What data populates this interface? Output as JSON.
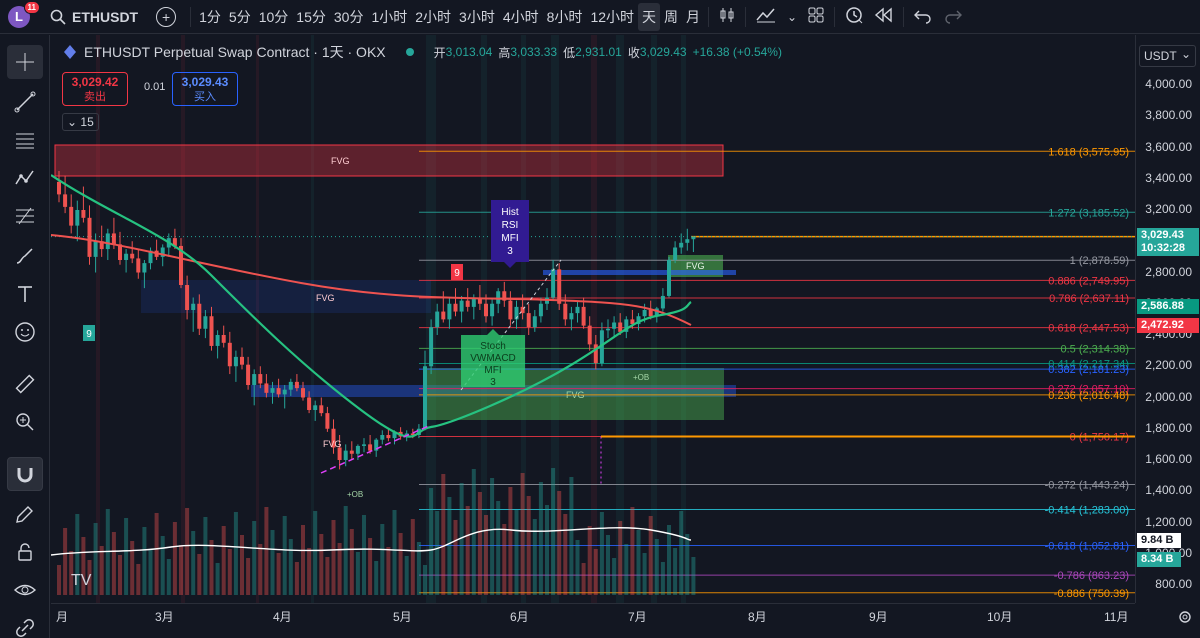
{
  "header": {
    "avatar_letter": "L",
    "notifications": "11",
    "symbol": "ETHUSDT",
    "intervals": [
      "1分",
      "5分",
      "10分",
      "15分",
      "30分",
      "1小时",
      "2小时",
      "3小时",
      "4小时",
      "8小时",
      "12小时",
      "天",
      "周",
      "月"
    ],
    "active_interval": "天"
  },
  "legend": {
    "title": "ETHUSDT Perpetual Swap Contract · 1天 · OKX",
    "open_label": "开",
    "open": "3,013.04",
    "high_label": "高",
    "high": "3,033.33",
    "low_label": "低",
    "low": "2,931.01",
    "close_label": "收",
    "close": "3,029.43",
    "change": "+16.38 (+0.54%)",
    "sell_price": "3,029.42",
    "sell_label": "卖出",
    "spread": "0.01",
    "buy_price": "3,029.43",
    "buy_label": "买入",
    "collapse_count": "15"
  },
  "price_axis": {
    "currency": "USDT",
    "ticks": [
      "4,000.00",
      "3,800.00",
      "3,600.00",
      "3,400.00",
      "3,200.00",
      "3,000.00",
      "2,800.00",
      "2,600.00",
      "2,400.00",
      "2,200.00",
      "2,000.00",
      "1,800.00",
      "1,600.00",
      "1,400.00",
      "1,200.00",
      "1,000.00",
      "800.00"
    ],
    "current_price": "3,029.43",
    "countdown": "10:32:28",
    "ma_green": "2,586.88",
    "ma_red": "2,472.92",
    "vol_white": "9.84 B",
    "vol_teal": "8.34 B"
  },
  "time_axis": {
    "labels": [
      "月",
      "3月",
      "4月",
      "5月",
      "6月",
      "7月",
      "8月",
      "9月",
      "10月",
      "11月"
    ]
  },
  "fib_levels": [
    {
      "label": "1.618 (3,575.95)",
      "color": "#ff9800"
    },
    {
      "label": "1.272 (3,185.52)",
      "color": "#26a69a"
    },
    {
      "label": "1 (2,878.59)",
      "color": "#9598a1"
    },
    {
      "label": "0.886 (2,749.95)",
      "color": "#f23645"
    },
    {
      "label": "0.786 (2,637.11)",
      "color": "#f23645"
    },
    {
      "label": "0.618 (2,447.53)",
      "color": "#f23645"
    },
    {
      "label": "0.5 (2,314.38)",
      "color": "#4caf50"
    },
    {
      "label": "0.414 (2,217.34)",
      "color": "#089981"
    },
    {
      "label": "0.382 (2,181.23)",
      "color": "#2962ff"
    },
    {
      "label": "0.272 (2,057.10)",
      "color": "#e91e63"
    },
    {
      "label": "0.236 (2,016.48)",
      "color": "#ff9800"
    },
    {
      "label": "0 (1,750.17)",
      "color": "#f23645"
    },
    {
      "label": "-0.272 (1,443.24)",
      "color": "#9598a1"
    },
    {
      "label": "-0.414 (1,283.00)",
      "color": "#26c6da"
    },
    {
      "label": "-0.618 (1,052.81)",
      "color": "#2962ff"
    },
    {
      "label": "-0.786 (863.23)",
      "color": "#ab47bc"
    },
    {
      "label": "-0.886 (750.39)",
      "color": "#ff9800"
    }
  ],
  "annotations": {
    "fvg": "FVG",
    "ob": "+OB",
    "hist_rsi": [
      "Hist",
      "RSI",
      "MFI",
      "3"
    ],
    "stoch": [
      "Stoch",
      "VWMACD",
      "MFI",
      "3"
    ],
    "nine": "9",
    "tv_logo": "TV"
  },
  "colors": {
    "up": "#26a69a",
    "down": "#ef5350",
    "accent": "#2962ff"
  }
}
